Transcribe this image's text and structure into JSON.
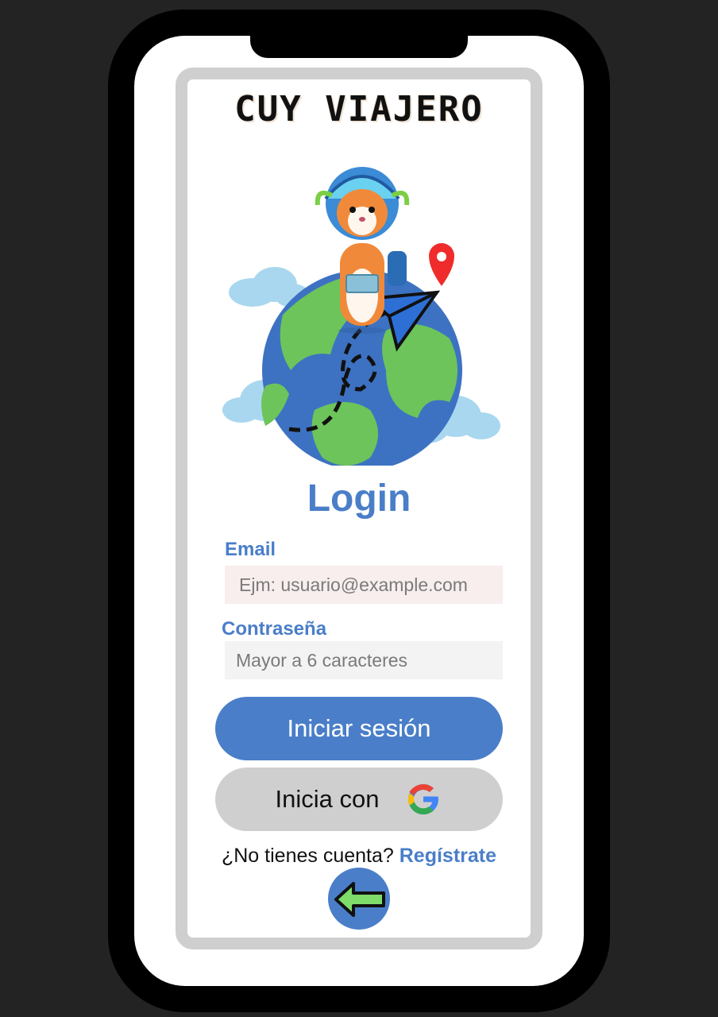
{
  "app": {
    "brand": "CUY VIAJERO"
  },
  "login": {
    "title": "Login",
    "email_label": "Email",
    "email_placeholder": "Ejm: usuario@example.com",
    "password_label": "Contraseña",
    "password_placeholder": "Mayor a 6 caracteres",
    "submit_label": "Iniciar sesión",
    "google_label": "Inicia con"
  },
  "signup": {
    "prompt": "¿No tienes cuenta?",
    "link": "Regístrate"
  },
  "icons": {
    "illustration": "guinea-pig-on-globe-illustration",
    "google": "google-g-icon",
    "back": "back-arrow-icon"
  },
  "colors": {
    "accent": "#4a7ec9",
    "secondary_button": "#cfcfcf",
    "email_field_bg": "#f8eeee",
    "password_field_bg": "#f3f3f3",
    "back_arrow": "#7ddc6a"
  }
}
